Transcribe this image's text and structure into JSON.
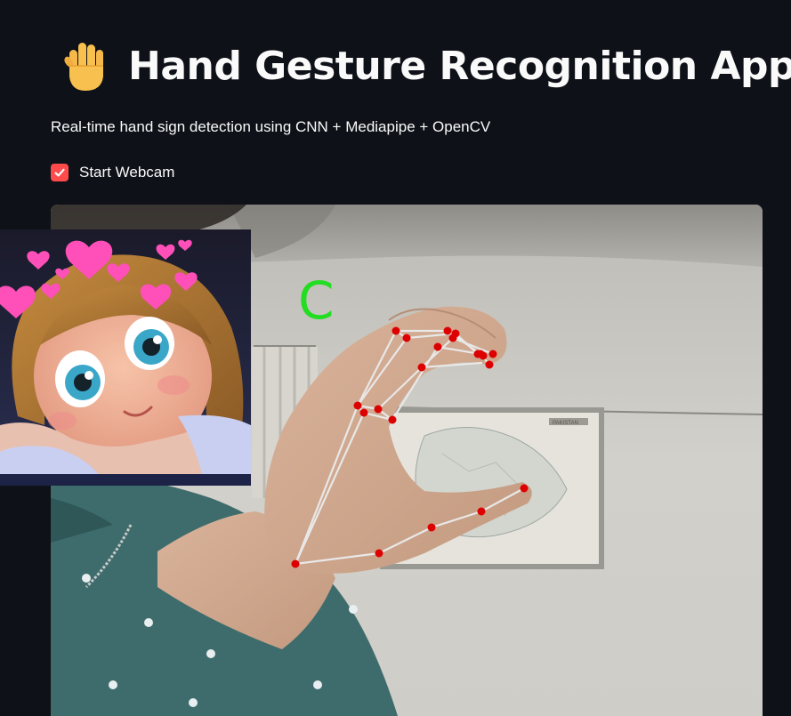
{
  "header": {
    "icon": "raised-hand-icon",
    "title": "Hand Gesture Recognition App",
    "subtitle": "Real-time hand sign detection using CNN + Mediapipe + OpenCV"
  },
  "controls": {
    "webcam_label": "Start Webcam",
    "webcam_checked": true
  },
  "video": {
    "prediction": "C",
    "map_label": "PAKISTAN"
  },
  "colors": {
    "background": "#0e1117",
    "accent": "#ff4b4b",
    "prediction": "#22dd22",
    "landmark": "#dd0000",
    "connection": "#e8e8e8"
  }
}
